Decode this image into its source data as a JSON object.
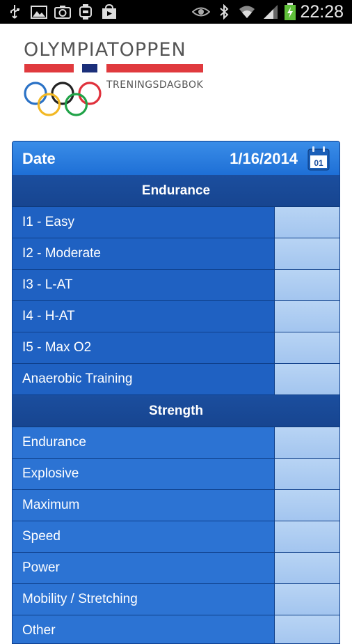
{
  "status_bar": {
    "time": "22:28",
    "icons": [
      "usb-icon",
      "gallery-icon",
      "camera-icon",
      "watch-icon",
      "play-store-icon",
      "eye-icon",
      "bluetooth-icon",
      "wifi-icon",
      "signal-icon",
      "battery-charging-icon"
    ]
  },
  "header": {
    "title": "OLYMPIATOPPEN",
    "subtitle": "TRENINGSDAGBOK",
    "colors": {
      "red": "#e03a3e",
      "navy": "#1b2f7a",
      "rings": [
        "#2b72c6",
        "#f2b824",
        "#222222",
        "#21a348",
        "#e0313c"
      ]
    }
  },
  "date_row": {
    "label": "Date",
    "value": "1/16/2014",
    "calendar_day": "01"
  },
  "sections": [
    {
      "title": "Endurance",
      "items": [
        "I1 - Easy",
        "I2 - Moderate",
        "I3 - L-AT",
        "I4 - H-AT",
        "I5 - Max O2",
        "Anaerobic Training"
      ]
    },
    {
      "title": "Strength",
      "items": [
        "Endurance",
        "Explosive",
        "Maximum",
        "Speed",
        "Power",
        "Mobility / Stretching",
        "Other"
      ]
    }
  ]
}
